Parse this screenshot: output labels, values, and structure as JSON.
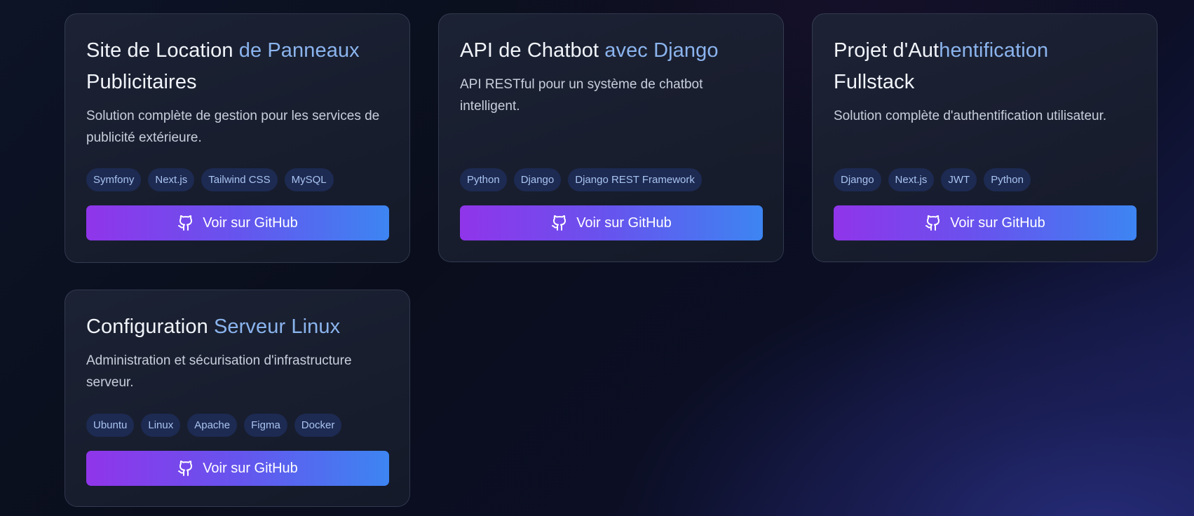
{
  "projects": [
    {
      "title_plain": "Site de Location ",
      "title_highlight": "de Panneaux",
      "title_end": "Publicitaires",
      "description": "Solution complète de gestion pour les services de publicité extérieure.",
      "tags": [
        "Symfony",
        "Next.js",
        "Tailwind CSS",
        "MySQL"
      ],
      "button_label": "Voir sur GitHub"
    },
    {
      "title_plain": "API de Chatbot ",
      "title_highlight": "avec Django",
      "title_end": "",
      "description": "API RESTful pour un système de chatbot intelligent.",
      "tags": [
        "Python",
        "Django",
        "Django REST Framework"
      ],
      "button_label": "Voir sur GitHub"
    },
    {
      "title_plain": "Projet d'Aut",
      "title_highlight": "hentification",
      "title_end": "Fullstack",
      "description": "Solution complète d'authentification utilisateur.",
      "tags": [
        "Django",
        "Next.js",
        "JWT",
        "Python"
      ],
      "button_label": "Voir sur GitHub"
    },
    {
      "title_plain": "Configuration ",
      "title_highlight": "Serveur Linux",
      "title_end": "",
      "description": "Administration et sécurisation d'infrastructure serveur.",
      "tags": [
        "Ubuntu",
        "Linux",
        "Apache",
        "Figma",
        "Docker"
      ],
      "button_label": "Voir sur GitHub"
    }
  ],
  "icons": {
    "button_icon": "github-icon"
  },
  "colors": {
    "title_highlight": "#8bb4ee",
    "tag_background": "#1d2a52",
    "tag_text": "#a8c4f0",
    "button_gradient_start": "#9035ea",
    "button_gradient_end": "#3d85f2"
  }
}
